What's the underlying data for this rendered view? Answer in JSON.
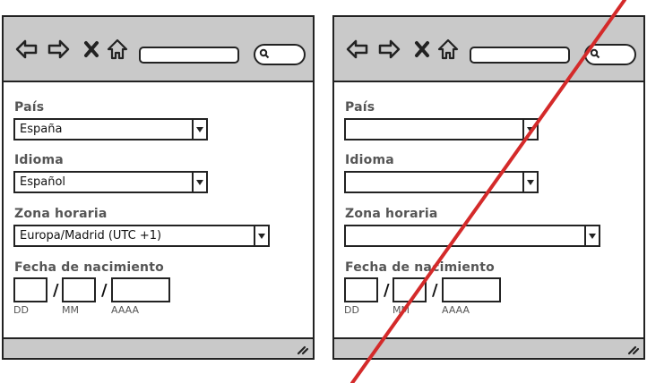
{
  "forms": [
    {
      "state": "filled",
      "fields": {
        "country": {
          "label": "País",
          "value": "España"
        },
        "language": {
          "label": "Idioma",
          "value": "Español"
        },
        "timezone": {
          "label": "Zona horaria",
          "value": "Europa/Madrid  (UTC +1)"
        },
        "birthdate": {
          "label": "Fecha de nacimiento",
          "separator": "/",
          "hints": {
            "day": "DD",
            "month": "MM",
            "year": "AAAA"
          }
        }
      }
    },
    {
      "state": "empty",
      "crossed_out": true,
      "fields": {
        "country": {
          "label": "País",
          "value": ""
        },
        "language": {
          "label": "Idioma",
          "value": ""
        },
        "timezone": {
          "label": "Zona horaria",
          "value": ""
        },
        "birthdate": {
          "label": "Fecha de nacimiento",
          "separator": "/",
          "hints": {
            "day": "DD",
            "month": "MM",
            "year": "AAAA"
          }
        }
      }
    }
  ],
  "icons": {
    "back": "back-arrow-icon",
    "forward": "forward-arrow-icon",
    "stop": "close-icon",
    "home": "home-icon",
    "search": "search-icon",
    "resize": "resize-grip-icon"
  },
  "colors": {
    "chrome": "#c9c9c9",
    "outline": "#222222",
    "label": "#555555",
    "strike": "#d42a2a"
  }
}
